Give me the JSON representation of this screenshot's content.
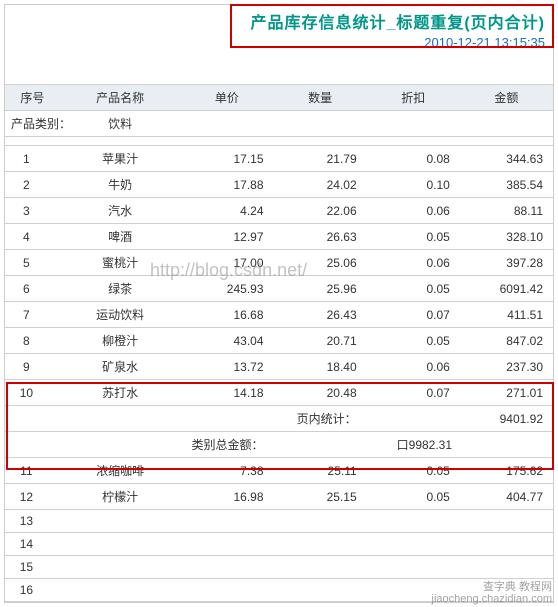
{
  "header": {
    "title": "产品库存信息统计_标题重复(页内合计)",
    "timestamp": "2010-12-21 13:15:35"
  },
  "columns": {
    "idx": "序号",
    "name": "产品名称",
    "price": "单价",
    "qty": "数量",
    "discount": "折扣",
    "amount": "金额"
  },
  "category": {
    "label": "产品类别：",
    "value": "饮料"
  },
  "rows": [
    {
      "idx": "1",
      "name": "苹果汁",
      "price": "17.15",
      "qty": "21.79",
      "discount": "0.08",
      "amount": "344.63"
    },
    {
      "idx": "2",
      "name": "牛奶",
      "price": "17.88",
      "qty": "24.02",
      "discount": "0.10",
      "amount": "385.54"
    },
    {
      "idx": "3",
      "name": "汽水",
      "price": "4.24",
      "qty": "22.06",
      "discount": "0.06",
      "amount": "88.11"
    },
    {
      "idx": "4",
      "name": "啤酒",
      "price": "12.97",
      "qty": "26.63",
      "discount": "0.05",
      "amount": "328.10"
    },
    {
      "idx": "5",
      "name": "蜜桃汁",
      "price": "17.00",
      "qty": "25.06",
      "discount": "0.06",
      "amount": "397.28"
    },
    {
      "idx": "6",
      "name": "绿茶",
      "price": "245.93",
      "qty": "25.96",
      "discount": "0.05",
      "amount": "6091.42"
    },
    {
      "idx": "7",
      "name": "运动饮料",
      "price": "16.68",
      "qty": "26.43",
      "discount": "0.07",
      "amount": "411.51"
    },
    {
      "idx": "8",
      "name": "柳橙汁",
      "price": "43.04",
      "qty": "20.71",
      "discount": "0.05",
      "amount": "847.02"
    },
    {
      "idx": "9",
      "name": "矿泉水",
      "price": "13.72",
      "qty": "18.40",
      "discount": "0.06",
      "amount": "237.30"
    },
    {
      "idx": "10",
      "name": "苏打水",
      "price": "14.18",
      "qty": "20.48",
      "discount": "0.07",
      "amount": "271.01"
    }
  ],
  "page_summary": {
    "label": "页内统计：",
    "amount": "9401.92"
  },
  "category_total": {
    "label": "类别总金额：",
    "amount": "口9982.31"
  },
  "rows2": [
    {
      "idx": "11",
      "name": "浓缩咖啡",
      "price": "7.38",
      "qty": "25.11",
      "discount": "0.05",
      "amount": "175.62"
    },
    {
      "idx": "12",
      "name": "柠檬汁",
      "price": "16.98",
      "qty": "25.15",
      "discount": "0.05",
      "amount": "404.77"
    }
  ],
  "empty_rows": [
    "13",
    "14",
    "15",
    "16"
  ],
  "watermark": "http://blog.csdn.net/",
  "footer": {
    "line1": "查字典 教程网",
    "line2": "jiaocheng.chazidian.com"
  }
}
